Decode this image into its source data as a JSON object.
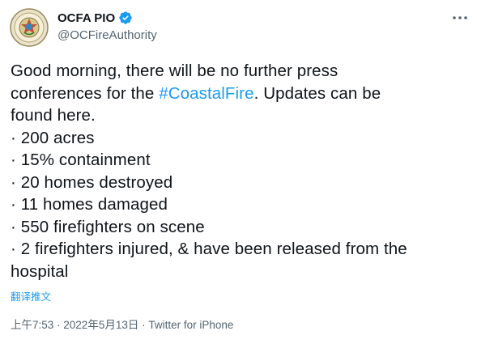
{
  "author": {
    "display_name": "OCFA PIO",
    "handle": "@OCFireAuthority",
    "avatar_icon": "ocfa-seal-icon",
    "verified_icon": "verified-badge-icon"
  },
  "more_icon": "more-horizontal-icon",
  "tweet": {
    "line1": "Good morning, there will be no further press",
    "line2_before": "conferences for the ",
    "hashtag": "#CoastalFire",
    "line2_after": ". Updates can be",
    "line3": "found here.",
    "bullets": [
      "· 200 acres",
      "· 15% containment",
      "· 20 homes destroyed",
      "· 11 homes damaged",
      "· 550 firefighters on scene",
      "· 2 firefighters injured, & have been released from the"
    ],
    "last_line": "hospital"
  },
  "translate_label": "翻译推文",
  "meta": {
    "time": "上午7:53",
    "separator1": " · ",
    "date": "2022年5月13日",
    "separator2": " · ",
    "source": "Twitter for iPhone"
  },
  "colors": {
    "accent": "#1d9bf0",
    "text": "#0f1419",
    "secondary": "#536471"
  }
}
